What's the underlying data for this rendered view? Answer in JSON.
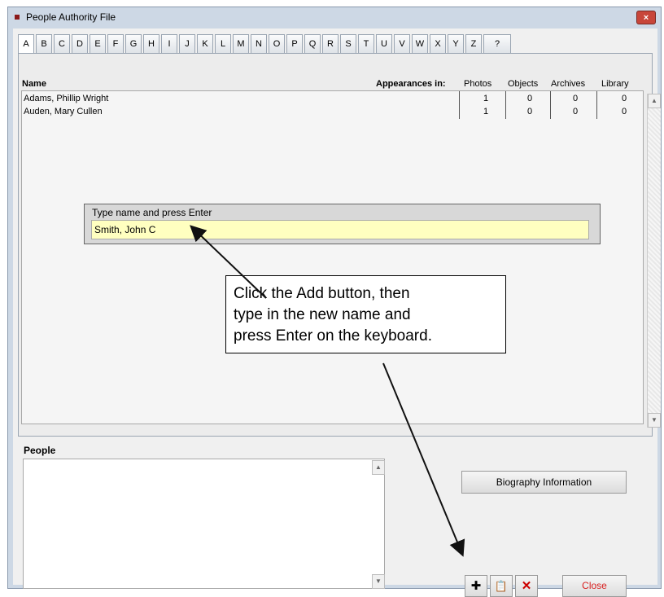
{
  "window": {
    "title": "People Authority File",
    "close_icon": "×"
  },
  "tabs": [
    "A",
    "B",
    "C",
    "D",
    "E",
    "F",
    "G",
    "H",
    "I",
    "J",
    "K",
    "L",
    "M",
    "N",
    "O",
    "P",
    "Q",
    "R",
    "S",
    "T",
    "U",
    "V",
    "W",
    "X",
    "Y",
    "Z",
    "?"
  ],
  "active_tab": "A",
  "table": {
    "name_header": "Name",
    "appearances_header": "Appearances in:",
    "columns": [
      "Photos",
      "Objects",
      "Archives",
      "Library"
    ],
    "rows": [
      {
        "name": "Adams, Phillip Wright",
        "counts": [
          "1",
          "0",
          "0",
          "0"
        ]
      },
      {
        "name": "Auden, Mary Cullen",
        "counts": [
          "1",
          "0",
          "0",
          "0"
        ]
      }
    ]
  },
  "name_dialog": {
    "label": "Type name and press Enter",
    "value": "Smith, John C"
  },
  "callout": {
    "line1": "Click the Add button, then",
    "line2": "type in the new name and",
    "line3": "press Enter on the keyboard."
  },
  "people": {
    "label": "People"
  },
  "buttons": {
    "biography": "Biography Information",
    "add_icon": "✚",
    "edit_icon": "📋",
    "delete_icon": "✕",
    "close": "Close"
  },
  "colors": {
    "input_bg": "#ffffc0",
    "close_text": "#d81f1f",
    "delete_icon": "#cc0000"
  }
}
